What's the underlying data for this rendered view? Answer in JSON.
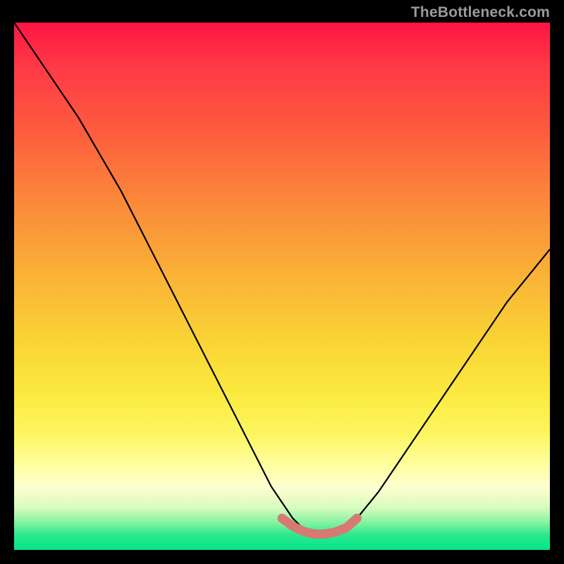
{
  "watermark": "TheBottleneck.com",
  "chart_data": {
    "type": "line",
    "title": "",
    "xlabel": "",
    "ylabel": "",
    "xlim": [
      0,
      100
    ],
    "ylim": [
      0,
      100
    ],
    "grid": false,
    "legend": false,
    "series": [
      {
        "name": "main-curve",
        "color": "#000000",
        "x": [
          0,
          4,
          8,
          12,
          16,
          20,
          24,
          28,
          32,
          36,
          40,
          44,
          48,
          52,
          54,
          56,
          58,
          60,
          62,
          64,
          68,
          72,
          76,
          80,
          84,
          88,
          92,
          96,
          100
        ],
        "y": [
          100,
          94,
          88,
          82,
          75,
          68,
          60,
          52,
          44,
          36,
          28,
          20,
          12,
          6,
          4,
          3,
          3,
          3,
          4,
          6,
          11,
          17,
          23,
          29,
          35,
          41,
          47,
          52,
          57
        ]
      },
      {
        "name": "valley-highlight",
        "color": "#d77a73",
        "x": [
          50,
          52,
          54,
          56,
          58,
          60,
          62,
          64
        ],
        "y": [
          6,
          4.5,
          3.5,
          3,
          3,
          3.4,
          4.2,
          6
        ]
      }
    ],
    "annotations": []
  }
}
